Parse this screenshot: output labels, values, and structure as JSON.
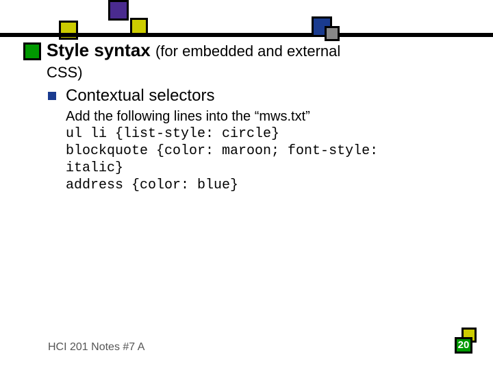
{
  "title": {
    "main": "Style syntax",
    "sub": "(for embedded and external",
    "line2": "CSS)"
  },
  "bullet": {
    "text": "Contextual selectors"
  },
  "body": {
    "intro": "Add the following lines into the “mws.txt”",
    "code1": "ul li {list-style: circle}",
    "code2": "blockquote {color: maroon; font-style: italic}",
    "code3": "address {color: blue}"
  },
  "footer": {
    "left": "HCI 201 Notes #7 A",
    "page": "20"
  }
}
